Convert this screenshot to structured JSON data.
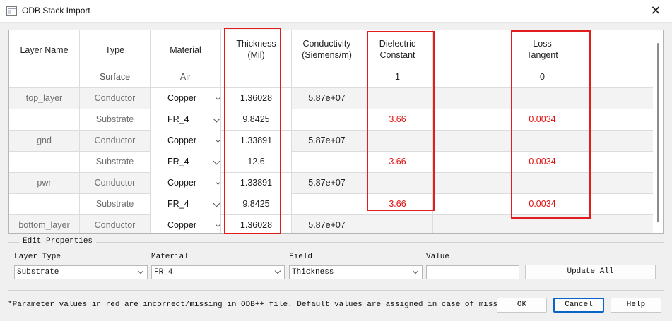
{
  "window": {
    "title": "ODB Stack Import",
    "close_glyph": "✕"
  },
  "table": {
    "headers": {
      "layer_name": {
        "line1": "Layer Name",
        "sub": ""
      },
      "type": {
        "line1": "Type",
        "sub": "Surface"
      },
      "material": {
        "line1": "Material",
        "sub": "Air"
      },
      "thickness": {
        "line1": "Thickness",
        "line2": "(Mil)",
        "sub": ""
      },
      "conductivity": {
        "line1": "Conductivity",
        "line2": "(Siemens/m)",
        "sub": ""
      },
      "dielectric": {
        "line1": "Dielectric",
        "line2": "Constant",
        "sub": "1"
      },
      "loss": {
        "line1": "Loss",
        "line2": "Tangent",
        "sub": "0"
      }
    },
    "rows": [
      {
        "layer": "top_layer",
        "type": "Conductor",
        "material": "Copper",
        "thickness": "1.36028",
        "conductivity": "5.87e+07",
        "dielectric": "",
        "loss": ""
      },
      {
        "layer": "",
        "type": "Substrate",
        "material": "FR_4",
        "thickness": "9.8425",
        "conductivity": "",
        "dielectric": "3.66",
        "loss": "0.0034"
      },
      {
        "layer": "gnd",
        "type": "Conductor",
        "material": "Copper",
        "thickness": "1.33891",
        "conductivity": "5.87e+07",
        "dielectric": "",
        "loss": ""
      },
      {
        "layer": "",
        "type": "Substrate",
        "material": "FR_4",
        "thickness": "12.6",
        "conductivity": "",
        "dielectric": "3.66",
        "loss": "0.0034"
      },
      {
        "layer": "pwr",
        "type": "Conductor",
        "material": "Copper",
        "thickness": "1.33891",
        "conductivity": "5.87e+07",
        "dielectric": "",
        "loss": ""
      },
      {
        "layer": "",
        "type": "Substrate",
        "material": "FR_4",
        "thickness": "9.8425",
        "conductivity": "",
        "dielectric": "3.66",
        "loss": "0.0034"
      },
      {
        "layer": "bottom_layer",
        "type": "Conductor",
        "material": "Copper",
        "thickness": "1.36028",
        "conductivity": "5.87e+07",
        "dielectric": "",
        "loss": ""
      }
    ]
  },
  "edit_properties": {
    "title": "Edit Properties",
    "layer_type": {
      "label": "Layer Type",
      "value": "Substrate"
    },
    "material": {
      "label": "Material",
      "value": "FR_4"
    },
    "field": {
      "label": "Field",
      "value": "Thickness"
    },
    "value": {
      "label": "Value",
      "value": ""
    },
    "update_all": "Update All"
  },
  "footer": {
    "note": "*Parameter values in red are incorrect/missing in ODB++ file. Default values are assigned in case of missing data.",
    "ok": "OK",
    "cancel": "Cancel",
    "help": "Help"
  },
  "colors": {
    "highlight_box": "#e11d1d",
    "missing_value": "#e01010",
    "default_button_border": "#0a64c8"
  },
  "icons": {
    "app": "stack-import-icon",
    "close": "close-icon",
    "dropdown": "chevron-down-icon"
  }
}
